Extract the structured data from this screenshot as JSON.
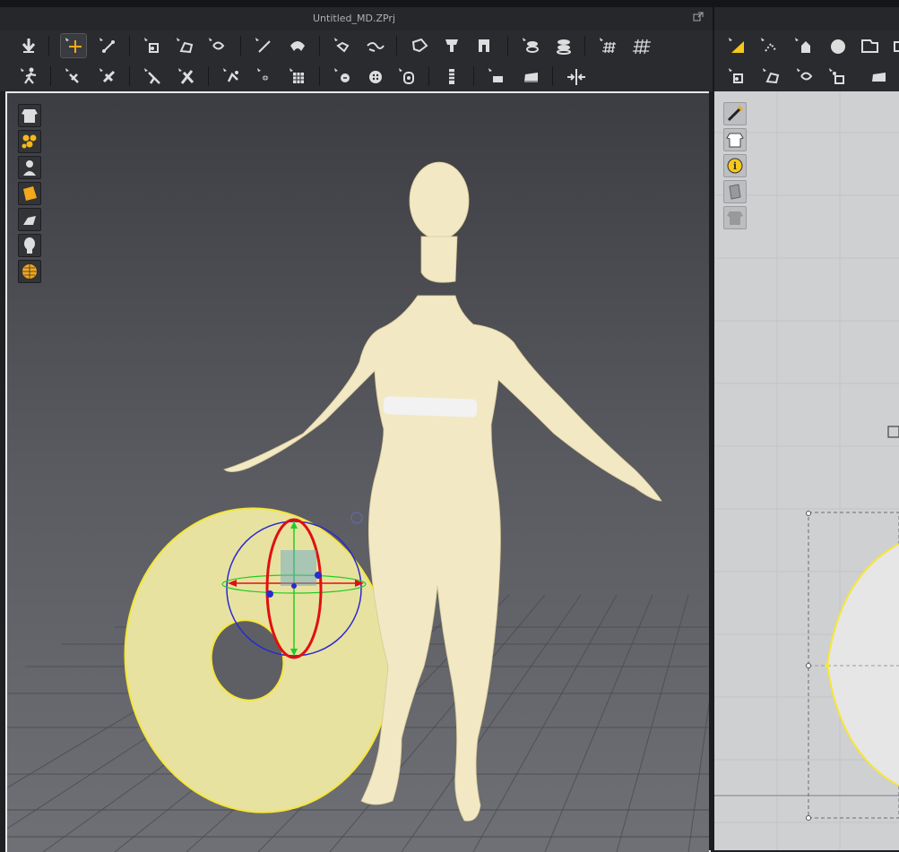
{
  "window": {
    "title": "Untitled_MD.ZPrj"
  },
  "toolbar_row1": {
    "icons": [
      "fold-arrow-icon",
      "transform-pattern-icon",
      "edit-pattern-icon",
      "segment-tool-icon",
      "polygon-tool-icon",
      "rectangle-tool-icon",
      "internal-line-icon",
      "seam-tool-icon",
      "segment-sewing-icon",
      "free-sewing-icon",
      "tack-icon",
      "fold-icon",
      "pin-icon",
      "layer-icon",
      "select-mesh-icon",
      "grid-icon",
      "mesh-grid-icon",
      "select-move-icon",
      "edit-point-icon",
      "add-point-icon",
      "circle-icon",
      "rectangle-icon",
      "more-icon"
    ]
  },
  "toolbar_row2": {
    "icons": [
      "avatar-pose-icon",
      "select-avatar-icon",
      "arrangement-icon",
      "fold-arrangement-icon",
      "strengthen-icon",
      "button-icon",
      "buttonhole-icon",
      "topstitch-icon",
      "zipper-icon",
      "tape-icon",
      "pleat-icon",
      "trim-icon",
      "measure-icon",
      "iron-icon",
      "shrink-icon",
      "segment-icon",
      "internal-polygon-icon",
      "dart-icon",
      "pattern-trace-icon",
      "iron-2d-icon"
    ]
  },
  "viewport3d": {
    "side_icons": [
      "garment-display-icon",
      "fabric-texture-icon",
      "avatar-display-icon",
      "surface-icon",
      "stress-map-icon",
      "avatar-silhouette-icon",
      "globe-display-icon"
    ]
  },
  "viewport2d": {
    "side_icons": [
      "pattern-brush-icon",
      "show-pattern-icon",
      "info-icon",
      "texture-icon",
      "garment-lock-icon"
    ]
  },
  "colors": {
    "accent_yellow": "#f5d21a",
    "pattern_fill": "#e8e2a0",
    "avatar_skin": "#f2e8c4",
    "gizmo_red": "#e01010",
    "gizmo_green": "#22cc22",
    "gizmo_blue": "#2a2ad0"
  }
}
